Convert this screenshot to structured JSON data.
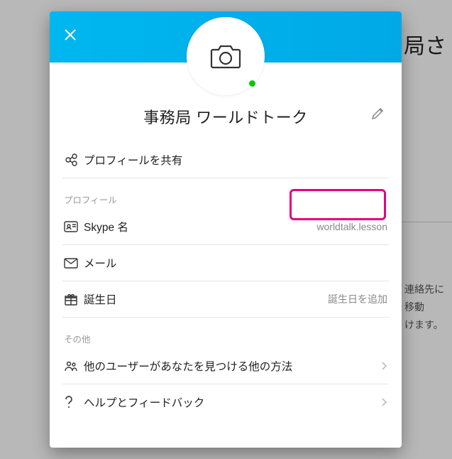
{
  "background": {
    "title_fragment": "局さ",
    "help_text_1": "連絡先に移動",
    "help_text_2": "けます。"
  },
  "modal": {
    "display_name": "事務局 ワールドトーク",
    "share_profile_label": "プロフィールを共有",
    "sections": {
      "profile_label": "プロフィール",
      "other_label": "その他"
    },
    "rows": {
      "skype_name": {
        "label": "Skype 名",
        "value": "worldtalk.lesson"
      },
      "email": {
        "label": "メール"
      },
      "birthday": {
        "label": "誕生日",
        "value": "誕生日を追加"
      },
      "discover": {
        "label": "他のユーザーがあなたを見つける他の方法"
      },
      "help": {
        "label": "ヘルプとフィードバック"
      }
    }
  }
}
